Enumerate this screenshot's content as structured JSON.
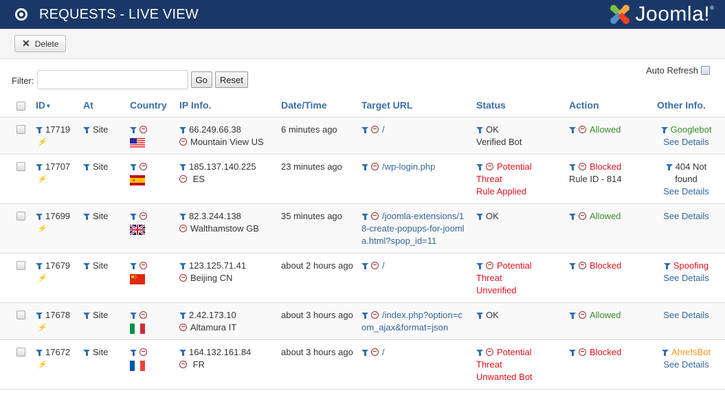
{
  "header": {
    "title": "REQUESTS - LIVE VIEW",
    "logo_text": "Joomla!",
    "logo_reg": "®"
  },
  "toolbar": {
    "delete_label": "Delete"
  },
  "filter": {
    "label": "Filter:",
    "value": "",
    "placeholder": "",
    "go_label": "Go",
    "reset_label": "Reset",
    "auto_refresh_label": "Auto Refresh",
    "auto_refresh_checked": false
  },
  "table": {
    "headers": {
      "id": "ID",
      "at": "At",
      "country": "Country",
      "ip": "IP Info.",
      "datetime": "Date/Time",
      "url": "Target URL",
      "status": "Status",
      "action": "Action",
      "other": "Other Info."
    },
    "sort_indicator": "▾",
    "see_details": "See Details",
    "rows": [
      {
        "id": "17719",
        "at": "Site",
        "country_code": "US",
        "ip": "66.249.66.38",
        "location": "Mountain View US",
        "datetime": "6 minutes ago",
        "url": "/",
        "status_line1": "OK",
        "status_line2": "Verified Bot",
        "status_line3": "",
        "action": "Allowed",
        "action_detail": "",
        "other": "Googlebot"
      },
      {
        "id": "17707",
        "at": "Site",
        "country_code": "ES",
        "ip": "185.137.140.225",
        "location": " ES",
        "datetime": "23 minutes ago",
        "url": "/wp-login.php",
        "status_line1": "Potential",
        "status_line2": "Threat",
        "status_line3": "Rule Applied",
        "action": "Blocked",
        "action_detail": "Rule ID - 814",
        "other": "404 Not found"
      },
      {
        "id": "17699",
        "at": "Site",
        "country_code": "GB",
        "ip": "82.3.244.138",
        "location": "Walthamstow GB",
        "datetime": "35 minutes ago",
        "url": "/joomla-extensions/18-create-popups-for-joomla.html?spop_id=11",
        "status_line1": "OK",
        "status_line2": "",
        "status_line3": "",
        "action": "Allowed",
        "action_detail": "",
        "other": ""
      },
      {
        "id": "17679",
        "at": "Site",
        "country_code": "CN",
        "ip": "123.125.71.41",
        "location": "Beijing CN",
        "datetime": "about 2 hours ago",
        "url": "/",
        "status_line1": "Potential",
        "status_line2": "Threat",
        "status_line3": "Unverified",
        "action": "Blocked",
        "action_detail": "",
        "other": "Spoofing"
      },
      {
        "id": "17678",
        "at": "Site",
        "country_code": "IT",
        "ip": "2.42.173.10",
        "location": "Altamura IT",
        "datetime": "about 3 hours ago",
        "url": "/index.php?option=com_ajax&format=json",
        "status_line1": "OK",
        "status_line2": "",
        "status_line3": "",
        "action": "Allowed",
        "action_detail": "",
        "other": ""
      },
      {
        "id": "17672",
        "at": "Site",
        "country_code": "FR",
        "ip": "164.132.161.84",
        "location": " FR",
        "datetime": "about 3 hours ago",
        "url": "/",
        "status_line1": "Potential",
        "status_line2": "Threat",
        "status_line3": "Unwanted Bot",
        "action": "Blocked",
        "action_detail": "",
        "other": "AhrefsBot"
      }
    ]
  },
  "colors": {
    "header_bg": "#1a3867",
    "link": "#336699",
    "allowed": "#3a8a2a",
    "blocked": "#e1121e",
    "warning": "#f49a1a"
  }
}
